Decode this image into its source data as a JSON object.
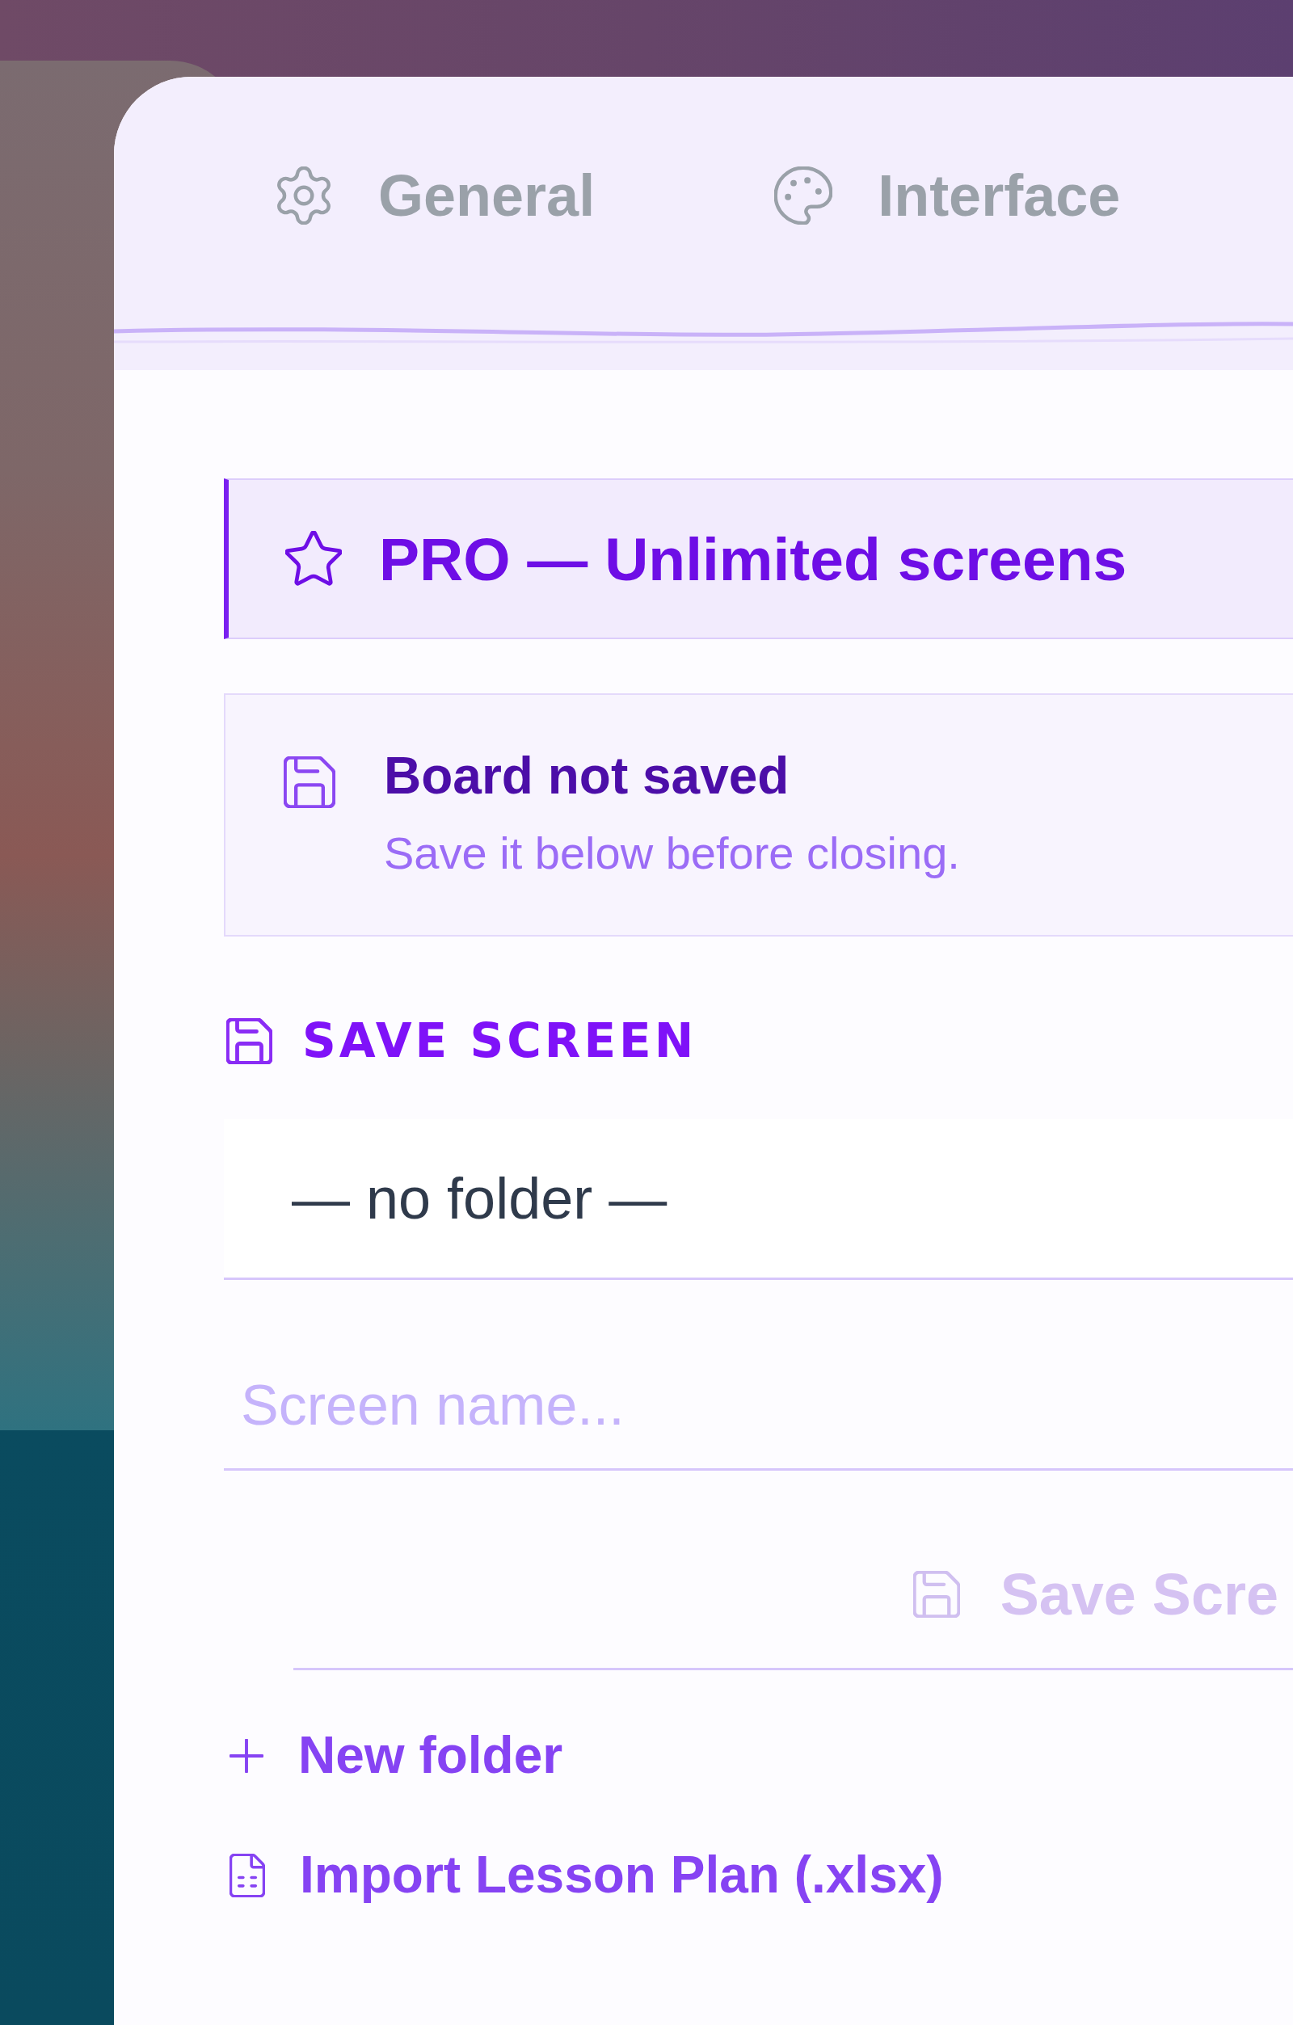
{
  "tabs": [
    {
      "label": "General",
      "selected": false
    },
    {
      "label": "Interface",
      "selected": false
    }
  ],
  "pro_banner": {
    "text": "PRO — Unlimited screens"
  },
  "notice": {
    "title": "Board not saved",
    "message": "Save it below before closing."
  },
  "save_screen": {
    "heading": "SAVE SCREEN",
    "folder_select": {
      "value": "— no folder —"
    },
    "name_field": {
      "placeholder": "Screen name..."
    },
    "save_button": {
      "label": "Save Scre",
      "disabled": true
    }
  },
  "links": [
    {
      "kind": "add",
      "label": "New folder"
    },
    {
      "kind": "import",
      "label": "Import Lesson Plan (.xlsx)"
    }
  ]
}
